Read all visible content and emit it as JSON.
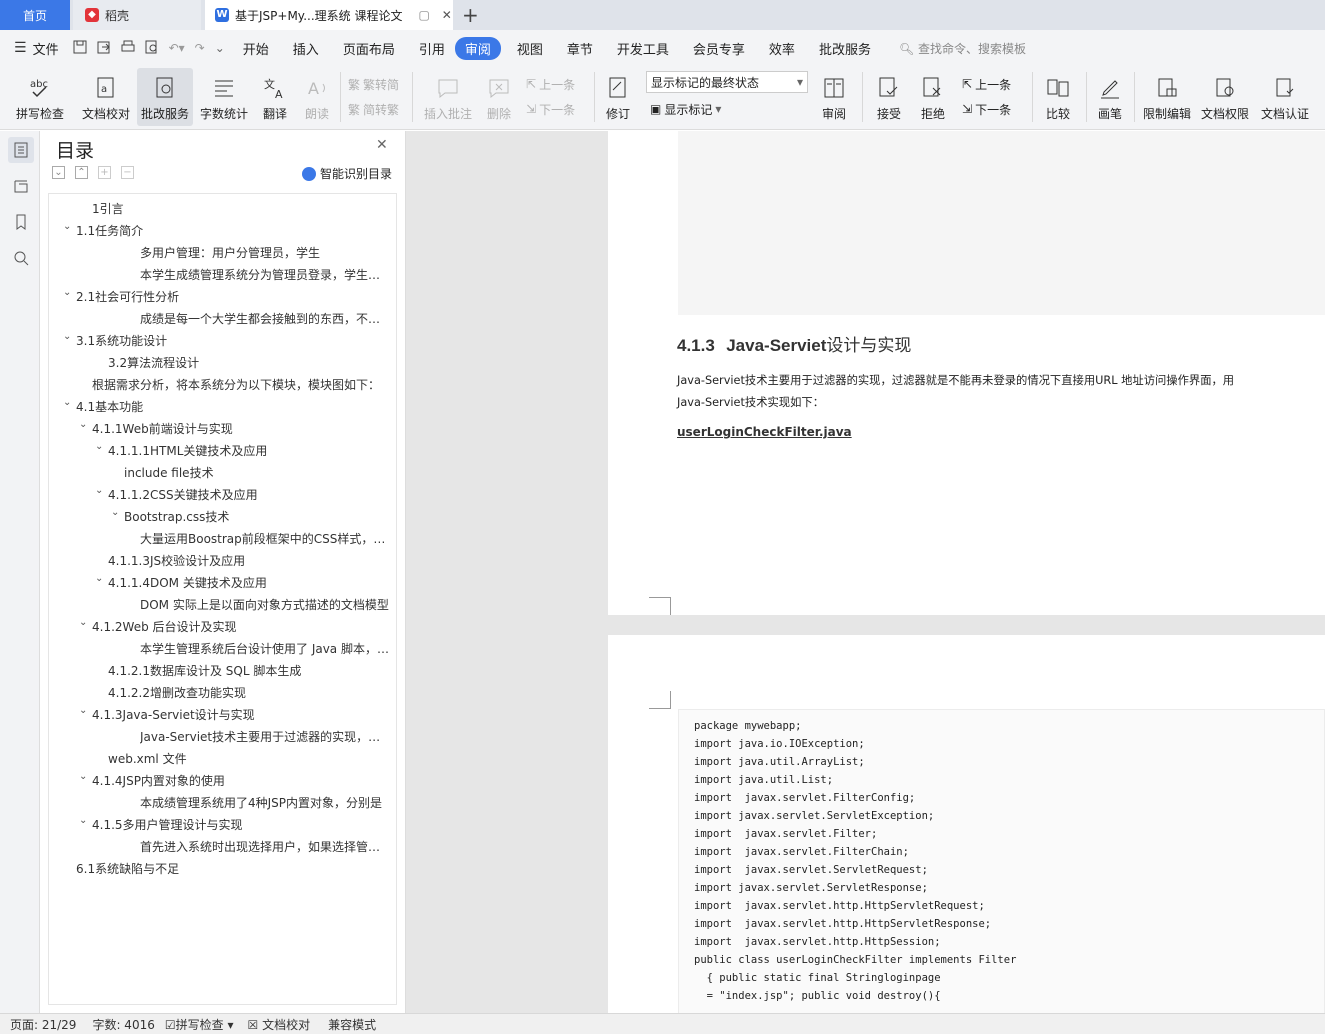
{
  "tabs": {
    "home": "首页",
    "daoke": "稻壳",
    "doc": "基于JSP+My...理系统 课程论文"
  },
  "menu": [
    "文件",
    "开始",
    "插入",
    "页面布局",
    "引用",
    "审阅",
    "视图",
    "章节",
    "开发工具",
    "会员专享",
    "效率",
    "批改服务"
  ],
  "search_placeholder": "查找命令、搜索模板",
  "toolbar": {
    "spell": "拼写检查",
    "proofread": "文档校对",
    "correct": "批改服务",
    "wordcount": "字数统计",
    "translate": "翻译",
    "read": "朗读",
    "trad": "繁转简",
    "simp": "简转繁",
    "insert_comment": "插入批注",
    "delete": "删除",
    "prev": "上一条",
    "next": "下一条",
    "revise": "修订",
    "show_state": "显示标记的最终状态",
    "show_marks": "显示标记",
    "review": "审阅",
    "accept": "接受",
    "reject": "拒绝",
    "prev2": "上一条",
    "next2": "下一条",
    "compare": "比较",
    "pen": "画笔",
    "restrict": "限制编辑",
    "perm": "文档权限",
    "auth": "文档认证"
  },
  "toc": {
    "title": "目录",
    "smart": "智能识别目录",
    "items": [
      "1引言",
      "1.1任务简介",
      "多用户管理：用户分管理员，学生",
      "本学生成绩管理系统分为管理员登录，学生登录，",
      "2.1社会可行性分析",
      "成绩是每一个大学生都会接触到的东西，不管是",
      "3.1系统功能设计",
      "3.2算法流程设计",
      "根据需求分析，将本系统分为以下模块，模块图如下：",
      "4.1基本功能",
      "4.1.1Web前端设计与实现",
      "4.1.1.1HTML关键技术及应用",
      "include file技术",
      "4.1.1.2CSS关键技术及应用",
      "Bootstrap.css技术",
      "大量运用Boostrap前段框架中的CSS样式，例如",
      "4.1.1.3JS校验设计及应用",
      "4.1.1.4DOM 关键技术及应用",
      "DOM 实际上是以面向对象方式描述的文档模型",
      "4.1.2Web 后台设计及实现",
      "本学生管理系统后台设计使用了 Java 脚本，连接",
      "4.1.2.1数据库设计及 SQL 脚本生成",
      "4.1.2.2增删改查功能实现",
      "4.1.3Java-Serviet设计与实现",
      "Java-Serviet技术主要用于过滤器的实现，过滤器就是",
      "web.xml 文件",
      "4.1.4JSP内置对象的使用",
      "本成绩管理系统用了4种JSP内置对象，分别是",
      "4.1.5多用户管理设计与实现",
      "首先进入系统时出现选择用户，如果选择管理员",
      "6.1系统缺陷与不足"
    ]
  },
  "doc": {
    "heading_num": "4.1.3",
    "heading_en": "Java-Serviet",
    "heading_cn": "设计与实现",
    "para1": "Java-Serviet技术主要用于过滤器的实现，过滤器就是不能再未登录的情况下直接用URL 地址访问操作界面，用",
    "para2": "Java-Serviet技术实现如下：",
    "filename": "userLoginCheckFilter.java",
    "code": [
      "package mywebapp;",
      "import java.io.IOException;",
      "import java.util.ArrayList;",
      "import java.util.List;",
      "import  javax.servlet.FilterConfig;",
      "import javax.servlet.ServletException;",
      "import  javax.servlet.Filter;",
      "import  javax.servlet.FilterChain;",
      "import  javax.servlet.ServletRequest;",
      "import javax.servlet.ServletResponse;",
      "import  javax.servlet.http.HttpServletRequest;",
      "import  javax.servlet.http.HttpServletResponse;",
      "import  javax.servlet.http.HttpSession;",
      "public class userLoginCheckFilter implements Filter",
      "  { public static final Stringloginpage",
      "  = \"index.jsp\"; public void destroy(){"
    ]
  },
  "status": {
    "page": "页面: 21/29",
    "words": "字数: 4016",
    "spell": "拼写检查",
    "proof": "文档校对",
    "compat": "兼容模式"
  }
}
